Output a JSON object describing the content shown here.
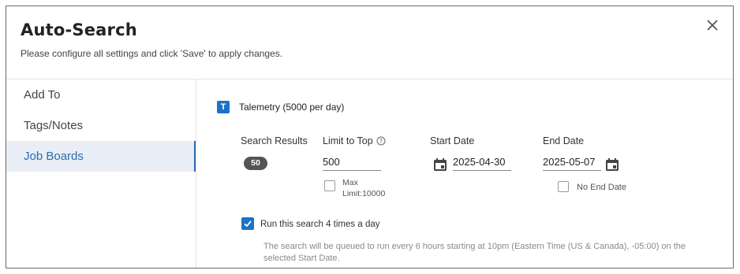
{
  "dialog": {
    "title": "Auto-Search",
    "subtitle": "Please configure all settings and click 'Save' to apply changes.",
    "close_icon": "close-icon"
  },
  "sidebar": {
    "items": [
      {
        "label": "Add To",
        "active": false
      },
      {
        "label": "Tags/Notes",
        "active": false
      },
      {
        "label": "Job Boards",
        "active": true
      }
    ]
  },
  "source": {
    "badge": "T",
    "title": "Talemetry (5000 per day)"
  },
  "columns": {
    "search_results": "Search Results",
    "limit_to_top": "Limit to Top",
    "start_date": "Start Date",
    "end_date": "End Date"
  },
  "values": {
    "result_count": "50",
    "limit": "500",
    "start_date": "2025-04-30",
    "end_date": "2025-05-07"
  },
  "options": {
    "max_limit_line1": "Max",
    "max_limit_line2": "Limit:10000",
    "max_limit_checked": false,
    "no_end_date": "No End Date",
    "no_end_date_checked": false,
    "run_label": "Run this search 4 times a day",
    "run_checked": true
  },
  "note": "The search will be queued to run every 6 hours starting at 10pm (Eastern Time (US & Canada), -05:00) on the selected Start Date.",
  "colors": {
    "accent": "#1a73c8",
    "active_nav_bg": "#e9eef6",
    "active_nav_text": "#2b6cb0"
  }
}
